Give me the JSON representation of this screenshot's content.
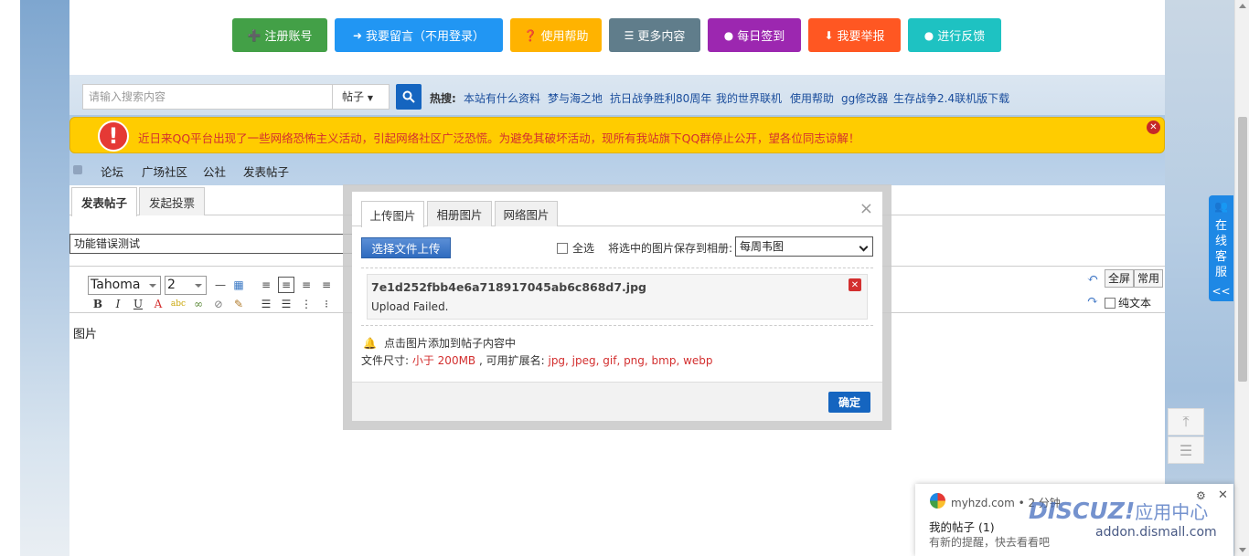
{
  "top_buttons": [
    {
      "label": "注册账号",
      "icon": "user-plus-icon",
      "glyph": "➕",
      "color": "#43a047"
    },
    {
      "label": "我要留言（不用登录）",
      "icon": "sign-in-icon",
      "glyph": "➜",
      "color": "#2196f3"
    },
    {
      "label": "使用帮助",
      "icon": "question-icon",
      "glyph": "❓",
      "color": "#ffb300"
    },
    {
      "label": "更多内容",
      "icon": "list-icon",
      "glyph": "☰",
      "color": "#607d8b"
    },
    {
      "label": "每日签到",
      "icon": "comments-icon",
      "glyph": "●",
      "color": "#9c27b0"
    },
    {
      "label": "我要举报",
      "icon": "download-icon",
      "glyph": "⬇",
      "color": "#ff5722"
    },
    {
      "label": "进行反馈",
      "icon": "comment-icon",
      "glyph": "●",
      "color": "#1ec2c2"
    }
  ],
  "search": {
    "placeholder": "请输入搜索内容",
    "type": "帖子",
    "hot_label": "热搜:",
    "hot_links": [
      "本站有什么资料",
      "梦与海之地",
      "抗日战争胜利80周年",
      "我的世界联机",
      "使用帮助",
      "gg修改器",
      "生存战争2.4联机版下载"
    ]
  },
  "notice": {
    "text": "近日来QQ平台出现了一些网络恐怖主义活动，引起网络社区广泛恐慌。为避免其破坏活动，现所有我站旗下QQ群停止公开，望各位同志谅解！",
    "colors": {
      "background": "#ffcc00",
      "text": "#d32f2f"
    }
  },
  "breadcrumb": [
    "论坛",
    "广场社区",
    "公社",
    "发表帖子"
  ],
  "editor": {
    "tabs": [
      "发表帖子",
      "发起投票"
    ],
    "subject_value": "功能错误测试",
    "font": "Tahoma",
    "font_size": "2",
    "right_buttons": {
      "fullscreen": "全屏",
      "common": "常用",
      "plain_text": "纯文本"
    },
    "body_text": "图片"
  },
  "modal": {
    "tabs": [
      "上传图片",
      "相册图片",
      "网络图片"
    ],
    "close_glyph": "×",
    "upload_button": "选择文件上传",
    "select_all": "全选",
    "save_label": "将选中的图片保存到相册:",
    "album_value": "每周韦图",
    "file_name": "7e1d252fbb4e6a718917045ab6c868d7.jpg",
    "file_status": "Upload Failed.",
    "hint_click": "点击图片添加到帖子内容中",
    "hint_size_prefix": "文件尺寸: ",
    "hint_size_value": "小于 200MB",
    "hint_ext_prefix": " , 可用扩展名: ",
    "hint_ext_value": "jpg, jpeg, gif, png, bmp, webp",
    "ok_button": "确定"
  },
  "side": {
    "customer_service": [
      "在",
      "线",
      "客",
      "服"
    ],
    "collapse": "<<"
  },
  "toast": {
    "source": "myhzd.com • 2 分钟",
    "title": "我的帖子 (1)",
    "body": "有新的提醒，快去看看吧"
  },
  "watermark": {
    "logo": "DISCUZ!",
    "logo_cn": "应用中心",
    "url": "addon.dismall.com"
  }
}
